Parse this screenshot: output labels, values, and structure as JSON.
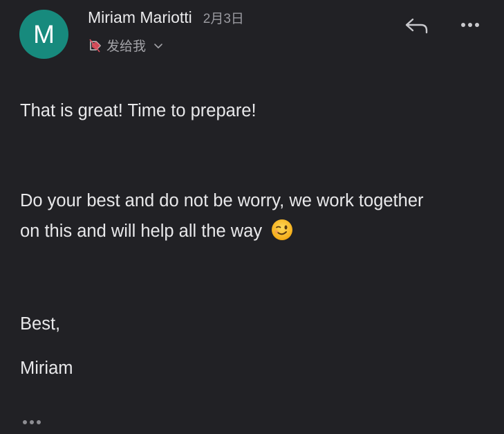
{
  "header": {
    "avatar_letter": "M",
    "avatar_color": "#178a7d",
    "sender_name": "Miriam Mariotti",
    "date": "2月3日",
    "recipient_label": "发给我"
  },
  "icons": {
    "tag": "tag-icon",
    "chevron": "chevron-down-icon",
    "reply": "reply-icon",
    "more": "more-horizontal-icon",
    "emoji": "winking-face-emoji",
    "trimmed": "show-trimmed-content-icon"
  },
  "message": {
    "line1": "That is great! Time to prepare!",
    "line2a": "Do your best and do not be worry, we work together",
    "line2b": "on this and will help all the way",
    "closing": "Best,",
    "signature": "Miriam"
  }
}
